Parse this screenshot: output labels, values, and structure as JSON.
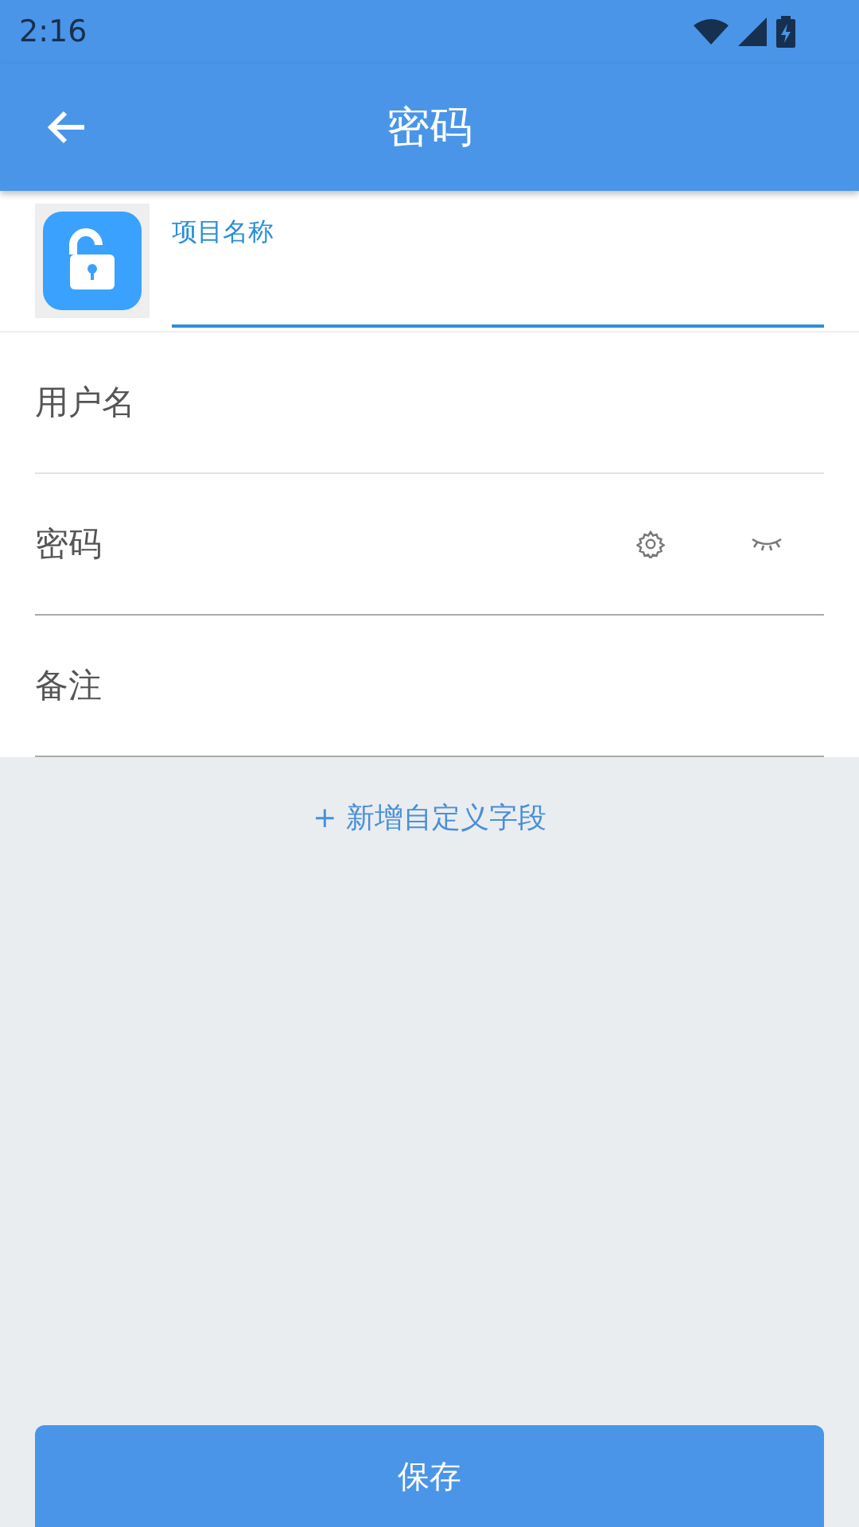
{
  "status_bar": {
    "time": "2:16"
  },
  "app_bar": {
    "title": "密码"
  },
  "name_field": {
    "label": "项目名称",
    "focused": true
  },
  "fields": [
    {
      "placeholder": "用户名",
      "kind": "text"
    },
    {
      "placeholder": "密码",
      "kind": "password"
    },
    {
      "placeholder": "备注",
      "kind": "text"
    }
  ],
  "add_field_link": "+ 新增自定义字段",
  "save_button": "保存"
}
